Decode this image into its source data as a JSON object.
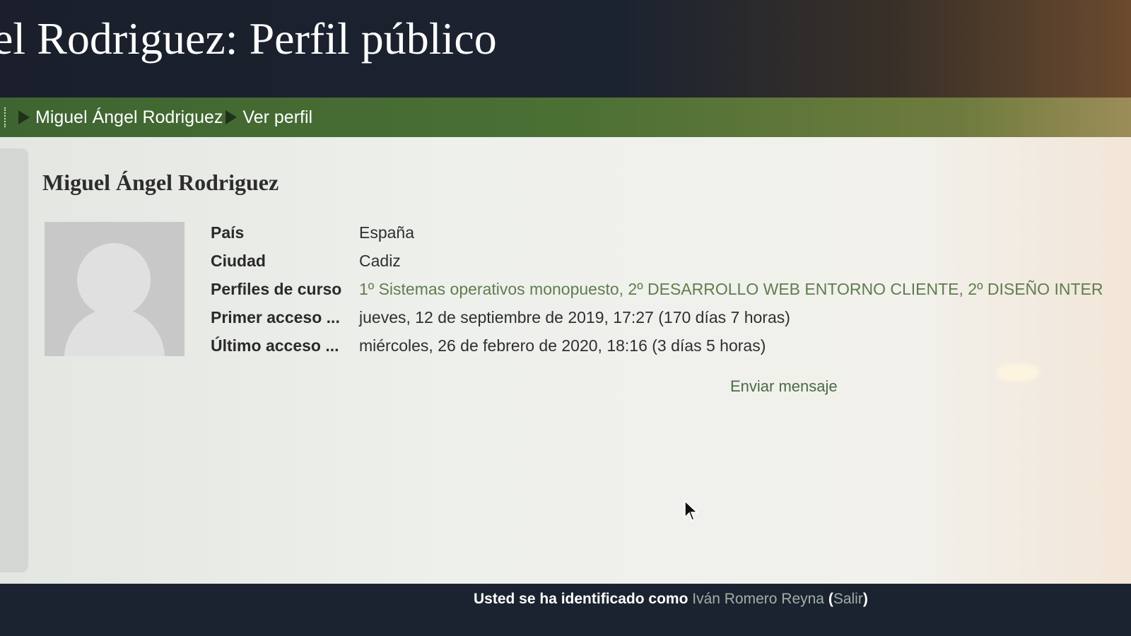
{
  "header": {
    "title": "el Rodriguez: Perfil público"
  },
  "breadcrumb": {
    "items": [
      "Miguel Ángel Rodriguez",
      "Ver perfil"
    ]
  },
  "profile": {
    "name": "Miguel Ángel Rodriguez",
    "fields": [
      {
        "label": "País",
        "value": "España"
      },
      {
        "label": "Ciudad",
        "value": "Cadiz"
      },
      {
        "label": "Perfiles de curso",
        "value": "1º Sistemas operativos monopuesto, 2º DESARROLLO WEB ENTORNO CLIENTE, 2º DISEÑO INTER"
      },
      {
        "label": "Primer acceso ...",
        "value": "jueves, 12 de septiembre de 2019, 17:27  (170 días 7 horas)"
      },
      {
        "label": "Último acceso ...",
        "value": "miércoles, 26 de febrero de 2020, 18:16  (3 días 5 horas)"
      }
    ],
    "send_message_label": "Enviar mensaje"
  },
  "footer": {
    "prefix": "Usted se ha identificado como ",
    "user_name": "Iván Romero Reyna",
    "open_paren": " (",
    "logout_label": "Salir",
    "close_paren": ")"
  },
  "colors": {
    "navbar": "#4b7034",
    "header_bg": "#1c2330",
    "link_green": "#5f7d4e"
  }
}
